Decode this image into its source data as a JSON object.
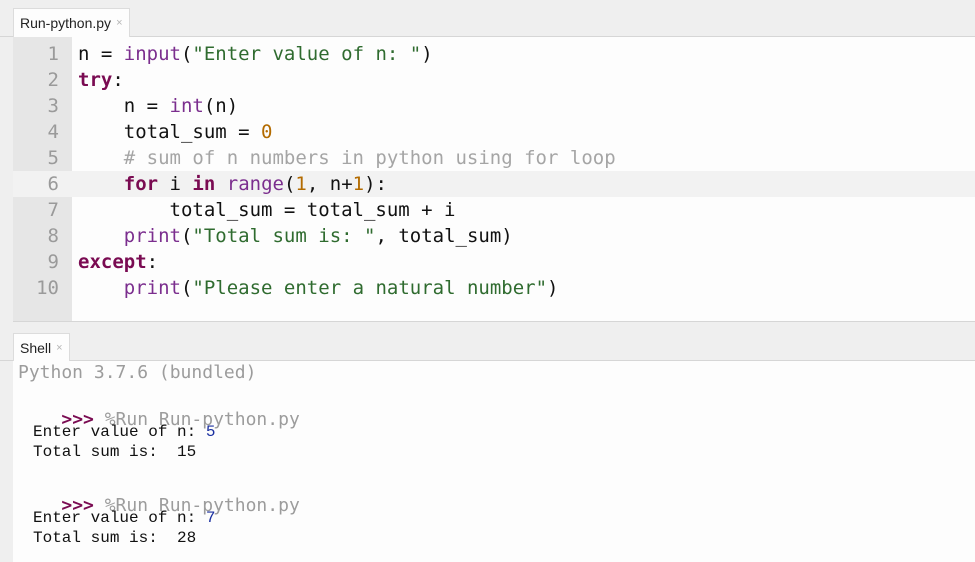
{
  "editor": {
    "tab": {
      "label": "Run-python.py",
      "close_glyph": "×"
    },
    "current_line": 6,
    "lines": [
      {
        "number": "1",
        "tokens": [
          {
            "t": "n = ",
            "c": ""
          },
          {
            "t": "input",
            "c": "bi"
          },
          {
            "t": "(",
            "c": ""
          },
          {
            "t": "\"Enter value of n: \"",
            "c": "str"
          },
          {
            "t": ")",
            "c": ""
          }
        ]
      },
      {
        "number": "2",
        "tokens": [
          {
            "t": "try",
            "c": "kw"
          },
          {
            "t": ":",
            "c": ""
          }
        ]
      },
      {
        "number": "3",
        "tokens": [
          {
            "t": "    n = ",
            "c": ""
          },
          {
            "t": "int",
            "c": "bi"
          },
          {
            "t": "(n)",
            "c": ""
          }
        ]
      },
      {
        "number": "4",
        "tokens": [
          {
            "t": "    total_sum = ",
            "c": ""
          },
          {
            "t": "0",
            "c": "num"
          }
        ]
      },
      {
        "number": "5",
        "tokens": [
          {
            "t": "    # sum of n numbers in python using for loop",
            "c": "cm"
          }
        ]
      },
      {
        "number": "6",
        "tokens": [
          {
            "t": "    ",
            "c": ""
          },
          {
            "t": "for",
            "c": "kw"
          },
          {
            "t": " i ",
            "c": ""
          },
          {
            "t": "in",
            "c": "kw"
          },
          {
            "t": " ",
            "c": ""
          },
          {
            "t": "range",
            "c": "bi"
          },
          {
            "t": "(",
            "c": ""
          },
          {
            "t": "1",
            "c": "num"
          },
          {
            "t": ", n+",
            "c": ""
          },
          {
            "t": "1",
            "c": "num"
          },
          {
            "t": "):",
            "c": ""
          }
        ]
      },
      {
        "number": "7",
        "tokens": [
          {
            "t": "        total_sum = total_sum + i",
            "c": ""
          }
        ]
      },
      {
        "number": "8",
        "tokens": [
          {
            "t": "    ",
            "c": ""
          },
          {
            "t": "print",
            "c": "bi"
          },
          {
            "t": "(",
            "c": ""
          },
          {
            "t": "\"Total sum is: \"",
            "c": "str"
          },
          {
            "t": ", total_sum)",
            "c": ""
          }
        ]
      },
      {
        "number": "9",
        "tokens": [
          {
            "t": "except",
            "c": "kw"
          },
          {
            "t": ":",
            "c": ""
          }
        ]
      },
      {
        "number": "10",
        "tokens": [
          {
            "t": "    ",
            "c": ""
          },
          {
            "t": "print",
            "c": "bi"
          },
          {
            "t": "(",
            "c": ""
          },
          {
            "t": "\"Please enter a natural number\"",
            "c": "str"
          },
          {
            "t": ")",
            "c": ""
          }
        ]
      }
    ]
  },
  "shell": {
    "tab": {
      "label": "Shell",
      "close_glyph": "×"
    },
    "banner": "Python 3.7.6 (bundled)",
    "prompt": ">>>",
    "runs": [
      {
        "command": "%Run Run-python.py",
        "prompt_text": "Enter value of n: ",
        "input_value": "5",
        "result_line": "Total sum is:  15"
      },
      {
        "command": "%Run Run-python.py",
        "prompt_text": "Enter value of n: ",
        "input_value": "7",
        "result_line": "Total sum is:  28"
      }
    ]
  }
}
